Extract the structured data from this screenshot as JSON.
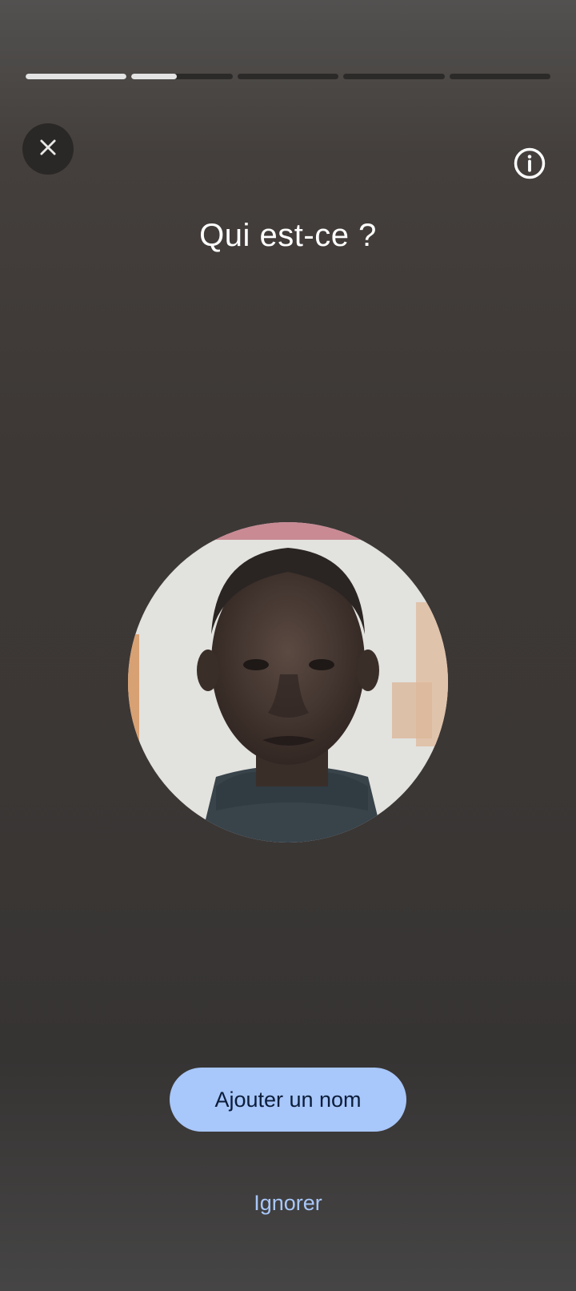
{
  "progress": {
    "segments": [
      {
        "fill": 1.0
      },
      {
        "fill": 0.45
      },
      {
        "fill": 0.0
      },
      {
        "fill": 0.0
      },
      {
        "fill": 0.0
      }
    ]
  },
  "header": {
    "close_icon": "close-icon",
    "info_icon": "info-icon"
  },
  "title": "Qui est-ce ?",
  "face": {
    "description_icon": "face-photo"
  },
  "actions": {
    "primary_label": "Ajouter un nom",
    "secondary_label": "Ignorer"
  },
  "colors": {
    "accent": "#a8c7fa",
    "progress_fill": "#e4e4e4",
    "background": "#3d3836"
  }
}
